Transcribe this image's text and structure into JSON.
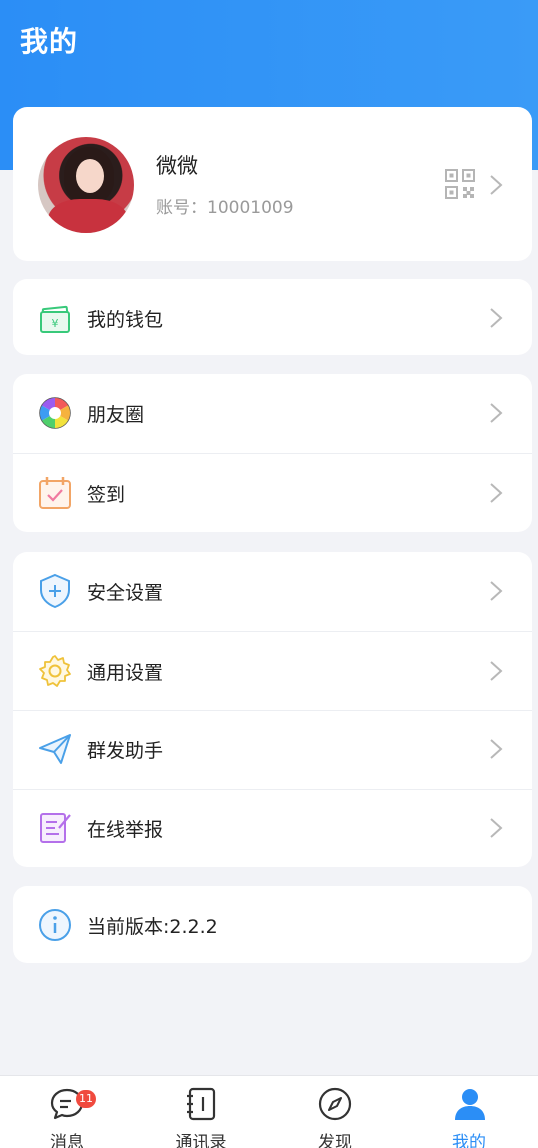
{
  "header": {
    "title": "我的"
  },
  "profile": {
    "name": "微微",
    "account": "账号：10001009"
  },
  "wallet": {
    "label": "我的钱包"
  },
  "social": [
    {
      "label": "朋友圈",
      "icon": "moments-icon"
    },
    {
      "label": "签到",
      "icon": "checkin-calendar-icon"
    }
  ],
  "settings": [
    {
      "label": "安全设置",
      "icon": "shield-icon"
    },
    {
      "label": "通用设置",
      "icon": "gear-icon"
    },
    {
      "label": "群发助手",
      "icon": "paper-plane-icon"
    },
    {
      "label": "在线举报",
      "icon": "report-edit-icon"
    }
  ],
  "version": {
    "label": "当前版本:2.2.2"
  },
  "tabs": [
    {
      "label": "消息",
      "badge": "11"
    },
    {
      "label": "通讯录"
    },
    {
      "label": "发现"
    },
    {
      "label": "我的"
    }
  ],
  "colors": {
    "accent": "#2b8ef6",
    "background": "#f2f3f7",
    "badge": "#f04a3e"
  }
}
